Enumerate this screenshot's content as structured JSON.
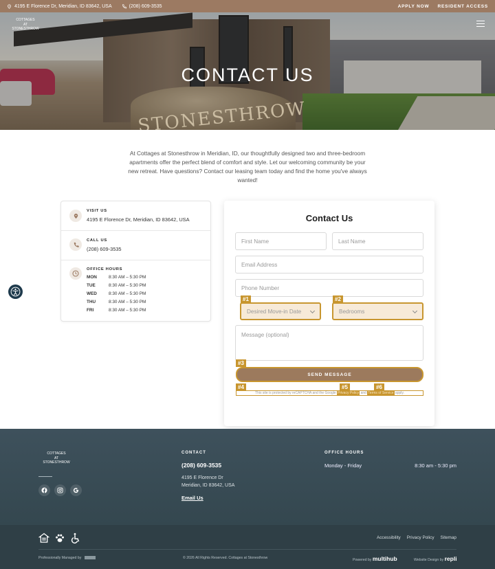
{
  "topbar": {
    "address": "4195 E Florence Dr, Meridian, ID 83642, USA",
    "phone": "(208) 609-3535",
    "apply_label": "APPLY NOW",
    "resident_label": "RESIDENT ACCESS",
    "bg_color": "#9c7a62"
  },
  "hero": {
    "logo_lines": [
      "COTTAGES",
      "AT",
      "STONESTHROW"
    ],
    "title": "CONTACT US",
    "sign_text": "STONESTHROW",
    "menu_icon": "hamburger-icon"
  },
  "intro": {
    "text": "At Cottages at Stonesthrow in Meridian, ID, our thoughtfully designed two and three-bedroom apartments offer the perfect blend of comfort and style. Let our welcoming community be your new retreat. Have questions? Contact our leasing team today and find the home you've always wanted!"
  },
  "info": {
    "visit_label": "VISIT US",
    "visit_value": "4195 E Florence Dr, Meridian, ID 83642, USA",
    "call_label": "CALL US",
    "call_value": "(208) 609-3535",
    "hours_label": "OFFICE HOURS",
    "hours": [
      {
        "day": "MON",
        "time": "8:30 AM – 5:30 PM"
      },
      {
        "day": "TUE",
        "time": "8:30 AM – 5:30 PM"
      },
      {
        "day": "WED",
        "time": "8:30 AM – 5:30 PM"
      },
      {
        "day": "THU",
        "time": "8:30 AM – 5:30 PM"
      },
      {
        "day": "FRI",
        "time": "8:30 AM – 5:30 PM"
      }
    ]
  },
  "form": {
    "title": "Contact Us",
    "first_name_placeholder": "First Name",
    "last_name_placeholder": "Last Name",
    "email_placeholder": "Email Address",
    "phone_placeholder": "Phone Number",
    "movein_value": "Desired Move-in Date",
    "bedrooms_value": "Bedrooms",
    "message_placeholder": "Message (optional)",
    "send_label": "SEND MESSAGE",
    "recaptcha_text": "This site is protected by reCAPTCHA and the Google",
    "privacy_link": "Privacy Policy",
    "and_text": "and",
    "terms_link": "Terms of Service",
    "apply_text": "apply.",
    "tags": [
      "#1",
      "#2",
      "#3",
      "#4",
      "#5",
      "#6"
    ],
    "highlight_color": "#c8962f"
  },
  "footer": {
    "logo_lines": [
      "COTTAGES",
      "AT",
      "STONESTHROW"
    ],
    "social": [
      "facebook-icon",
      "instagram-icon",
      "google-icon"
    ],
    "contact_label": "CONTACT",
    "phone": "(208) 609-3535",
    "address_line1": "4195 E Florence Dr",
    "address_line2": "Meridian, ID 83642, USA",
    "email_label": "Email Us",
    "hours_label": "OFFICE HOURS",
    "hours_days": "Monday - Friday",
    "hours_time": "8:30 am - 5:30 pm"
  },
  "subfooter": {
    "links": [
      "Accessibility",
      "Privacy Policy",
      "Sitemap"
    ],
    "managed_by": "Professionally Managed by",
    "copyright": "© 2026 All Rights Reserved. Cottages at Stonesthrow",
    "powered_by": "Powered by",
    "powered_brand": "multihub",
    "design_by": "Website Design by",
    "design_brand": "repli"
  }
}
